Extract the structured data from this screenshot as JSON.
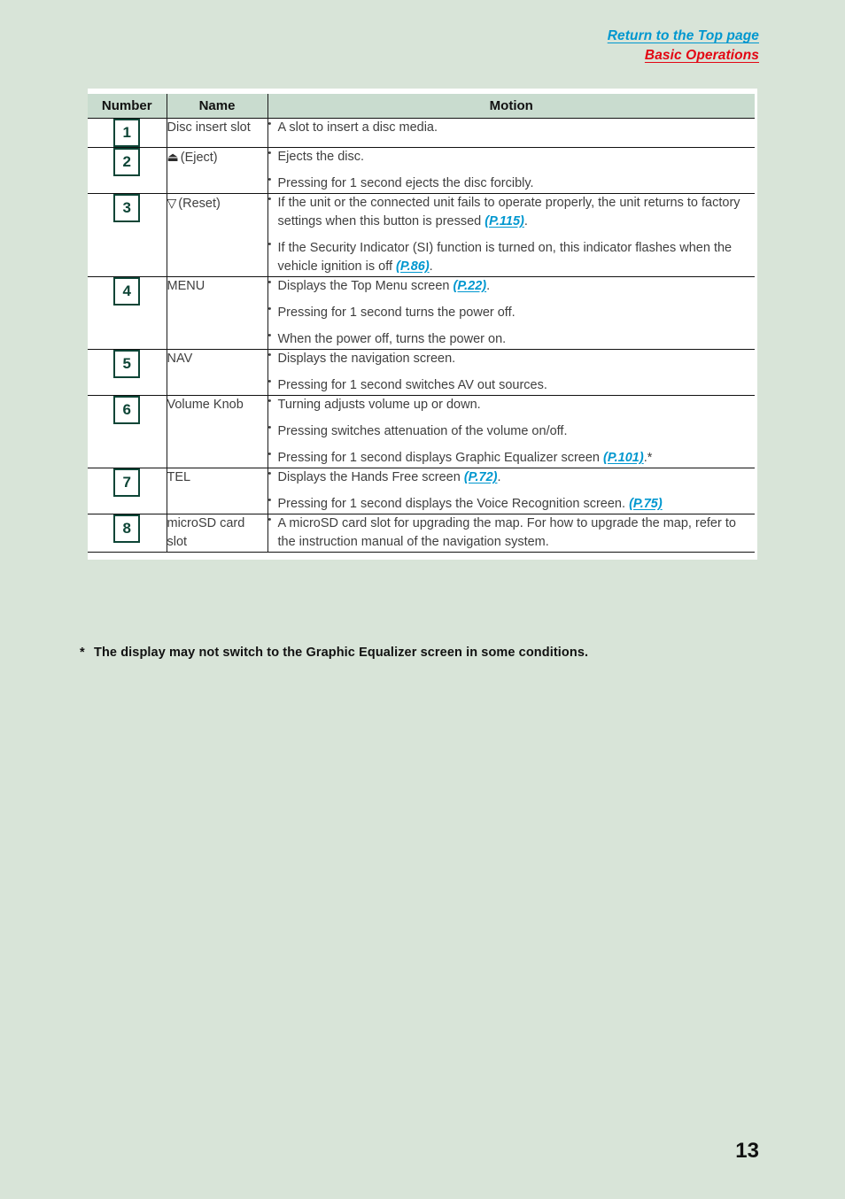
{
  "header": {
    "top_link": "Return to the Top page",
    "section_link": "Basic Operations",
    "top_link_color": "#0097cf",
    "section_link_color": "#e30613"
  },
  "table": {
    "columns": [
      "Number",
      "Name",
      "Motion"
    ],
    "rows": [
      {
        "number": "1",
        "name": "Disc insert slot",
        "glyph": "",
        "motions": [
          {
            "parts": [
              {
                "text": "A slot to insert a disc media."
              }
            ]
          }
        ]
      },
      {
        "number": "2",
        "name": "(Eject)",
        "glyph": "⏏",
        "glyph_name": "eject-icon",
        "motions": [
          {
            "parts": [
              {
                "text": "Ejects the disc."
              }
            ]
          },
          {
            "parts": [
              {
                "text": "Pressing for 1 second ejects the disc forcibly."
              }
            ]
          }
        ]
      },
      {
        "number": "3",
        "name": "(Reset)",
        "glyph": "▽",
        "glyph_name": "reset-triangle-icon",
        "motions": [
          {
            "parts": [
              {
                "text": "If the unit or the connected unit fails to operate properly, the unit returns to factory settings when this button is pressed "
              },
              {
                "text": "(P.115)",
                "link": true
              },
              {
                "text": "."
              }
            ]
          },
          {
            "parts": [
              {
                "text": "If the Security Indicator (SI) function is turned on, this indicator flashes when the vehicle ignition is off "
              },
              {
                "text": "(P.86)",
                "link": true
              },
              {
                "text": "."
              }
            ]
          }
        ]
      },
      {
        "number": "4",
        "name": "MENU",
        "glyph": "",
        "motions": [
          {
            "parts": [
              {
                "text": "Displays the Top Menu screen "
              },
              {
                "text": "(P.22)",
                "link": true
              },
              {
                "text": "."
              }
            ]
          },
          {
            "parts": [
              {
                "text": "Pressing for 1 second turns the power off."
              }
            ]
          },
          {
            "parts": [
              {
                "text": "When the power off, turns the power on."
              }
            ]
          }
        ]
      },
      {
        "number": "5",
        "name": "NAV",
        "glyph": "",
        "motions": [
          {
            "parts": [
              {
                "text": "Displays the navigation screen."
              }
            ]
          },
          {
            "parts": [
              {
                "text": "Pressing for 1 second switches AV out sources."
              }
            ]
          }
        ]
      },
      {
        "number": "6",
        "name": "Volume Knob",
        "glyph": "",
        "motions": [
          {
            "parts": [
              {
                "text": "Turning adjusts volume up or down."
              }
            ]
          },
          {
            "parts": [
              {
                "text": "Pressing switches attenuation of the volume on/off."
              }
            ]
          },
          {
            "parts": [
              {
                "text": "Pressing for 1 second displays Graphic Equalizer screen "
              },
              {
                "text": "(P.101)",
                "link": true
              },
              {
                "text": ".*"
              }
            ]
          }
        ]
      },
      {
        "number": "7",
        "name": "TEL",
        "glyph": "",
        "motions": [
          {
            "parts": [
              {
                "text": "Displays the Hands Free screen "
              },
              {
                "text": "(P.72)",
                "link": true
              },
              {
                "text": "."
              }
            ]
          },
          {
            "parts": [
              {
                "text": "Pressing for 1 second displays the Voice Recognition screen. "
              },
              {
                "text": "(P.75)",
                "link": true
              }
            ]
          }
        ]
      },
      {
        "number": "8",
        "name": "microSD card slot",
        "glyph": "",
        "motions": [
          {
            "parts": [
              {
                "text": "A microSD card slot for upgrading the map. For how to upgrade the map, refer to the instruction manual of the navigation system."
              }
            ]
          }
        ]
      }
    ]
  },
  "footnote": {
    "marker": "*",
    "text": "The display may not switch to the Graphic Equalizer screen in some conditions."
  },
  "page_number": "13"
}
